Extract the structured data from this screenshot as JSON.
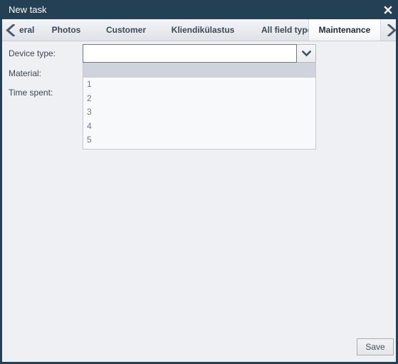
{
  "window": {
    "title": "New task",
    "close_icon": "close-icon",
    "accent_color": "#234055",
    "background_color": "#eef0f4"
  },
  "tabs": {
    "scroll_left_icon": "chevron-left-icon",
    "scroll_right_icon": "chevron-right-icon",
    "items": [
      {
        "label": "eral",
        "full_label": "General",
        "active": false,
        "partial": true
      },
      {
        "label": "Photos",
        "full_label": "Photos",
        "active": false,
        "partial": false
      },
      {
        "label": "Customer",
        "full_label": "Customer",
        "active": false,
        "partial": false
      },
      {
        "label": "Kliendikülastus",
        "full_label": "Kliendikülastus",
        "active": false,
        "partial": false
      },
      {
        "label": "All field types",
        "full_label": "All field types",
        "active": false,
        "partial": false
      },
      {
        "label": "Maintenance",
        "full_label": "Maintenance",
        "active": true,
        "partial": false
      }
    ]
  },
  "form": {
    "fields": [
      {
        "label": "Device type:"
      },
      {
        "label": "Material:"
      },
      {
        "label": "Time spent:"
      }
    ],
    "device_type": {
      "value": "",
      "placeholder": "",
      "dropdown_icon": "chevron-down-icon",
      "expanded": true,
      "options": [
        {
          "label": "",
          "selected": true
        },
        {
          "label": "1",
          "selected": false
        },
        {
          "label": "2",
          "selected": false
        },
        {
          "label": "3",
          "selected": false
        },
        {
          "label": "4",
          "selected": false
        },
        {
          "label": "5",
          "selected": false
        }
      ]
    }
  },
  "footer": {
    "save_label": "Save"
  }
}
